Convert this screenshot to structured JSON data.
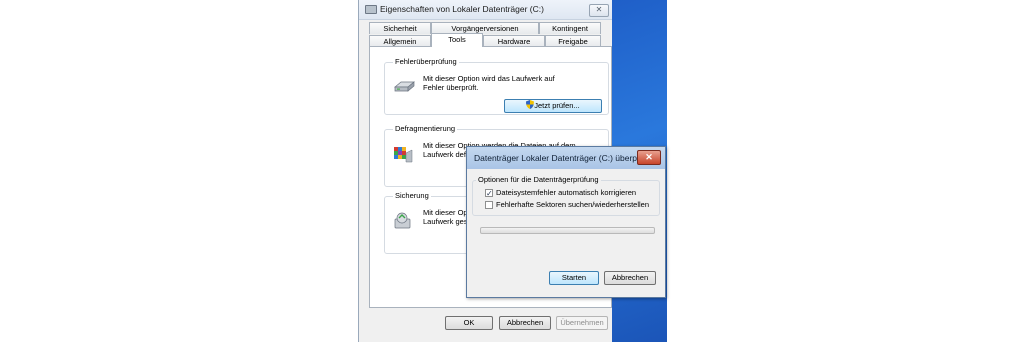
{
  "properties_window": {
    "title": "Eigenschaften von Lokaler Datenträger (C:)",
    "close_label": "✕",
    "tabs_row1": [
      "Sicherheit",
      "Vorgängerversionen",
      "Kontingent"
    ],
    "tabs_row2": [
      "Allgemein",
      "Tools",
      "Hardware",
      "Freigabe"
    ],
    "active_tab": "Tools",
    "groups": {
      "error_check": {
        "label": "Fehlerüberprüfung",
        "text_line1": "Mit dieser Option wird das Laufwerk auf",
        "text_line2": "Fehler überprüft.",
        "button": "Jetzt prüfen..."
      },
      "defrag": {
        "label": "Defragmentierung",
        "text_line1": "Mit dieser Option werden die Dateien auf dem",
        "text_line2": "Laufwerk defragmentiert."
      },
      "backup": {
        "label": "Sicherung",
        "text_line1": "Mit dieser Option werden die Dateien auf dem",
        "text_line2": "Laufwerk gesichert."
      }
    },
    "buttons": {
      "ok": "OK",
      "cancel": "Abbrechen",
      "apply": "Übernehmen"
    }
  },
  "check_dialog": {
    "title": "Datenträger Lokaler Datenträger (C:) überprüfen",
    "close_label": "✕",
    "options_label": "Optionen für die Datenträgerprüfung",
    "options": [
      {
        "label": "Dateisystemfehler automatisch korrigieren",
        "checked": true,
        "check_glyph": "✓"
      },
      {
        "label": "Fehlerhafte Sektoren suchen/wiederherstellen",
        "checked": false,
        "check_glyph": ""
      }
    ],
    "progress": 0,
    "buttons": {
      "start": "Starten",
      "cancel": "Abbrechen"
    }
  },
  "icons": {
    "drive": "drive-icon",
    "defrag": "defrag-icon",
    "backup": "backup-icon",
    "shield": "uac-shield-icon"
  },
  "colors": {
    "accent": "#3c7fb1",
    "desktop": "#2a78dc",
    "progress_fill": "#37b24d"
  }
}
